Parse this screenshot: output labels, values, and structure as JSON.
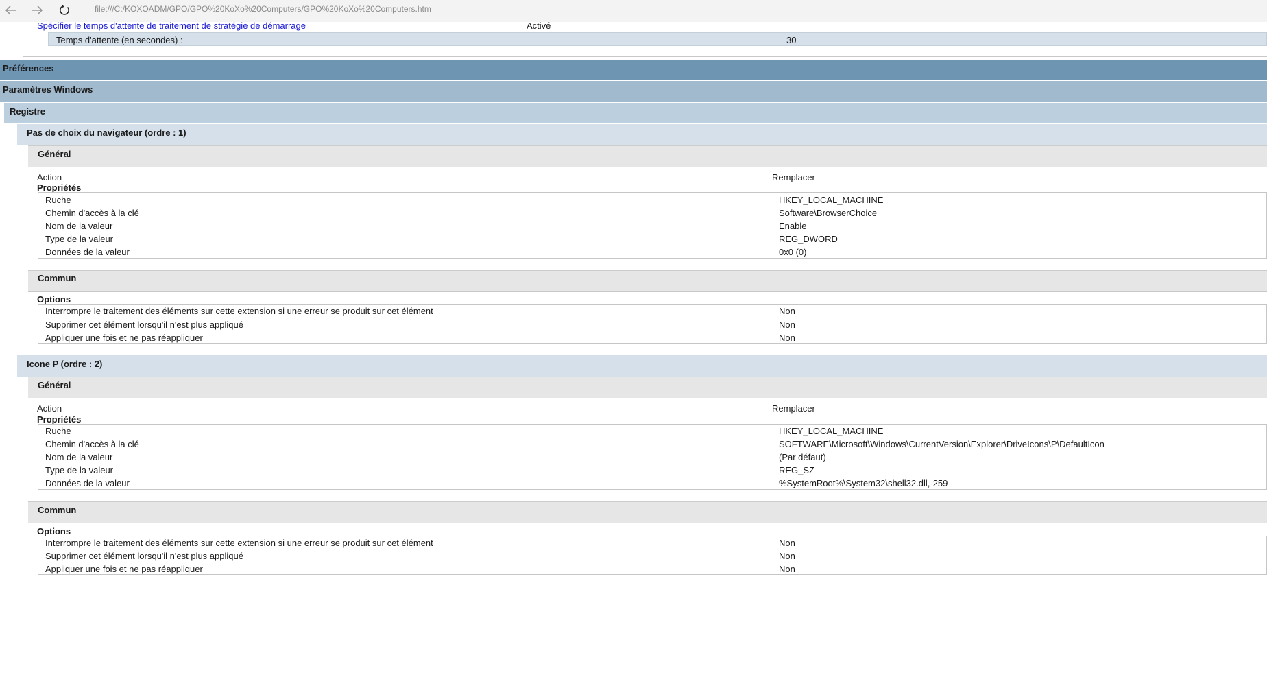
{
  "browser": {
    "address": "file:///C:/KOXOADM/GPO/GPO%20KoXo%20Computers/GPO%20KoXo%20Computers.htm",
    "back_icon": "arrow-left-icon",
    "forward_icon": "arrow-right-icon",
    "refresh_icon": "refresh-icon"
  },
  "policy": {
    "link": "Spécifier le temps d'attente de traitement de stratégie de démarrage",
    "state": "Activé",
    "sub_label": "Temps d'attente (en secondes) :",
    "sub_value": "30"
  },
  "sections": {
    "preferences": "Préférences",
    "windows_settings": "Paramètres Windows",
    "registry": "Registre"
  },
  "items": [
    {
      "title": "Pas de choix du navigateur (ordre : 1)",
      "general_header": "Général",
      "action_label": "Action",
      "action_value": "Remplacer",
      "properties_label": "Propriétés",
      "properties": [
        {
          "label": "Ruche",
          "value": "HKEY_LOCAL_MACHINE"
        },
        {
          "label": "Chemin d'accès à la clé",
          "value": "Software\\BrowserChoice"
        },
        {
          "label": "Nom de la valeur",
          "value": "Enable"
        },
        {
          "label": "Type de la valeur",
          "value": "REG_DWORD"
        },
        {
          "label": "Données de la valeur",
          "value": "0x0 (0)"
        }
      ],
      "common_header": "Commun",
      "options_label": "Options",
      "options": [
        {
          "label": "Interrompre le traitement des éléments sur cette extension si une erreur se produit sur cet élément",
          "value": "Non"
        },
        {
          "label": "Supprimer cet élément lorsqu'il n'est plus appliqué",
          "value": "Non"
        },
        {
          "label": "Appliquer une fois et ne pas réappliquer",
          "value": "Non"
        }
      ]
    },
    {
      "title": "Icone P (ordre : 2)",
      "general_header": "Général",
      "action_label": "Action",
      "action_value": "Remplacer",
      "properties_label": "Propriétés",
      "properties": [
        {
          "label": "Ruche",
          "value": "HKEY_LOCAL_MACHINE"
        },
        {
          "label": "Chemin d'accès à la clé",
          "value": "SOFTWARE\\Microsoft\\Windows\\CurrentVersion\\Explorer\\DriveIcons\\P\\DefaultIcon"
        },
        {
          "label": "Nom de la valeur",
          "value": "(Par défaut)"
        },
        {
          "label": "Type de la valeur",
          "value": "REG_SZ"
        },
        {
          "label": "Données de la valeur",
          "value": "%SystemRoot%\\System32\\shell32.dll,-259"
        }
      ],
      "common_header": "Commun",
      "options_label": "Options",
      "options": [
        {
          "label": "Interrompre le traitement des éléments sur cette extension si une erreur se produit sur cet élément",
          "value": "Non"
        },
        {
          "label": "Supprimer cet élément lorsqu'il n'est plus appliqué",
          "value": "Non"
        },
        {
          "label": "Appliquer une fois et ne pas réappliquer",
          "value": "Non"
        }
      ]
    }
  ]
}
